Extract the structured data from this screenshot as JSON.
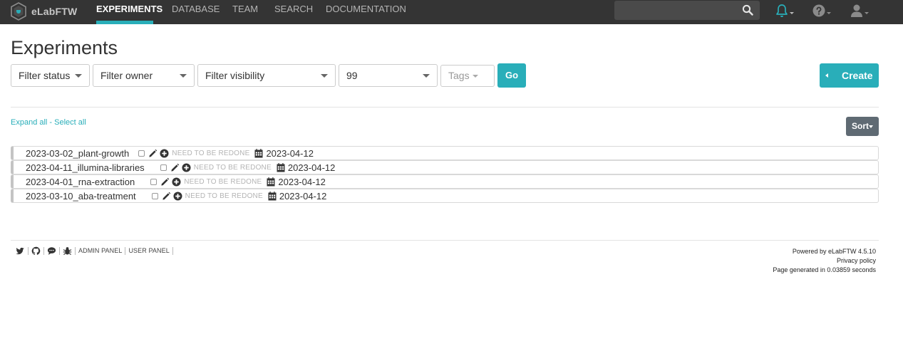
{
  "app": {
    "name": "eLabFTW"
  },
  "nav": {
    "links": [
      "EXPERIMENTS",
      "DATABASE",
      "TEAM",
      "SEARCH",
      "DOCUMENTATION"
    ],
    "search_placeholder": ""
  },
  "page": {
    "title": "Experiments"
  },
  "filters": {
    "status": "Filter status",
    "owner": "Filter owner",
    "visibility": "Filter visibility",
    "limit": "99",
    "tags": "Tags",
    "go": "Go"
  },
  "actions": {
    "create": "Create",
    "sort": "Sort"
  },
  "bulk": {
    "expand_all": "Expand all",
    "separator": " - ",
    "select_all": "Select all"
  },
  "experiments": [
    {
      "title": "2023-03-02_plant-growth",
      "status": "NEED TO BE REDONE",
      "date": "2023-04-12"
    },
    {
      "title": "2023-04-11_illumina-libraries",
      "status": "NEED TO BE REDONE",
      "date": "2023-04-12"
    },
    {
      "title": "2023-04-01_rna-extraction",
      "status": "NEED TO BE REDONE",
      "date": "2023-04-12"
    },
    {
      "title": "2023-03-10_aba-treatment",
      "status": "NEED TO BE REDONE",
      "date": "2023-04-12"
    }
  ],
  "footer": {
    "links": [
      "ADMIN PANEL",
      "USER PANEL"
    ],
    "powered_by_prefix": "Powered by ",
    "powered_by_link": "eLabFTW 4.5.10",
    "privacy": "Privacy policy",
    "generated": "Page generated in 0.03859 seconds"
  },
  "colors": {
    "accent": "#29aeb9",
    "navbar": "#343434",
    "sort_button": "#5f6a73"
  },
  "icons": [
    "hexagon-logo-icon",
    "search-icon",
    "bell-icon",
    "help-icon",
    "user-icon",
    "edit-icon",
    "plus-circle-icon",
    "calendar-icon",
    "twitter-icon",
    "github-icon",
    "chat-icon",
    "bug-icon"
  ]
}
